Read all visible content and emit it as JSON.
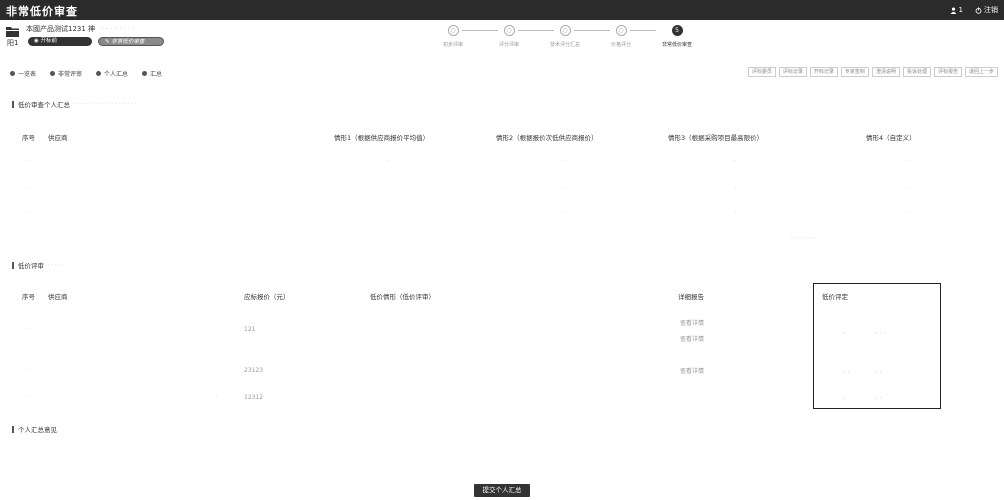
{
  "topbar": {
    "title": "非常低价审查",
    "user_label": "1",
    "logout_label": "注销"
  },
  "project": {
    "name": "本國产品测试1231 神",
    "name_hint": "· · ·  ·  · · · ·",
    "sub": "阳1",
    "pill1": "  ◉ 开标前",
    "pill2": "✎ 非常低价审查"
  },
  "steps": [
    {
      "num": "○",
      "label": "初步评审"
    },
    {
      "num": "○",
      "label": "评分评审"
    },
    {
      "num": "○",
      "label": "技术评分汇总"
    },
    {
      "num": "○",
      "label": "价格评分"
    },
    {
      "num": "5",
      "label": "非常低价审查"
    }
  ],
  "tabs": [
    "一览表",
    "非常评审",
    "个人汇总",
    "汇总"
  ],
  "actions": [
    "评标委员",
    "评标记录",
    "开标记录",
    "专家签到",
    "澄清说明",
    "投诉处理",
    "评标报告",
    "退回上一步"
  ],
  "section1": {
    "title": "低价审查个人汇总",
    "hint": "· · · · · · · · · · · · · · · · · · · ·"
  },
  "table1": {
    "headers": {
      "no": "序号",
      "supplier": "供应商",
      "c1": "情形1（根据供应商报价平均值）",
      "c2": "情形2（根据报价次低供应商报价）",
      "c3": "情形3（根据采购项目最高限价）",
      "c4": "情形4（自定义）"
    }
  },
  "section2": {
    "title": "低价评审",
    "hint": "· · · · ·"
  },
  "table2": {
    "headers": {
      "no": "序号",
      "supplier": "供应商",
      "price": "应标报价（元）",
      "situation": "低价情形（低价评审）",
      "report": "详细报告",
      "judge": "低价评定"
    },
    "rows": [
      {
        "price": "121",
        "report": [
          "查看详情",
          "查看详情"
        ]
      },
      {
        "price": "23123",
        "report": [
          "查看详情"
        ]
      },
      {
        "price": "12312",
        "report": []
      }
    ]
  },
  "section3": {
    "title": "个人汇总意见"
  },
  "submit_label": "提交个人汇总"
}
